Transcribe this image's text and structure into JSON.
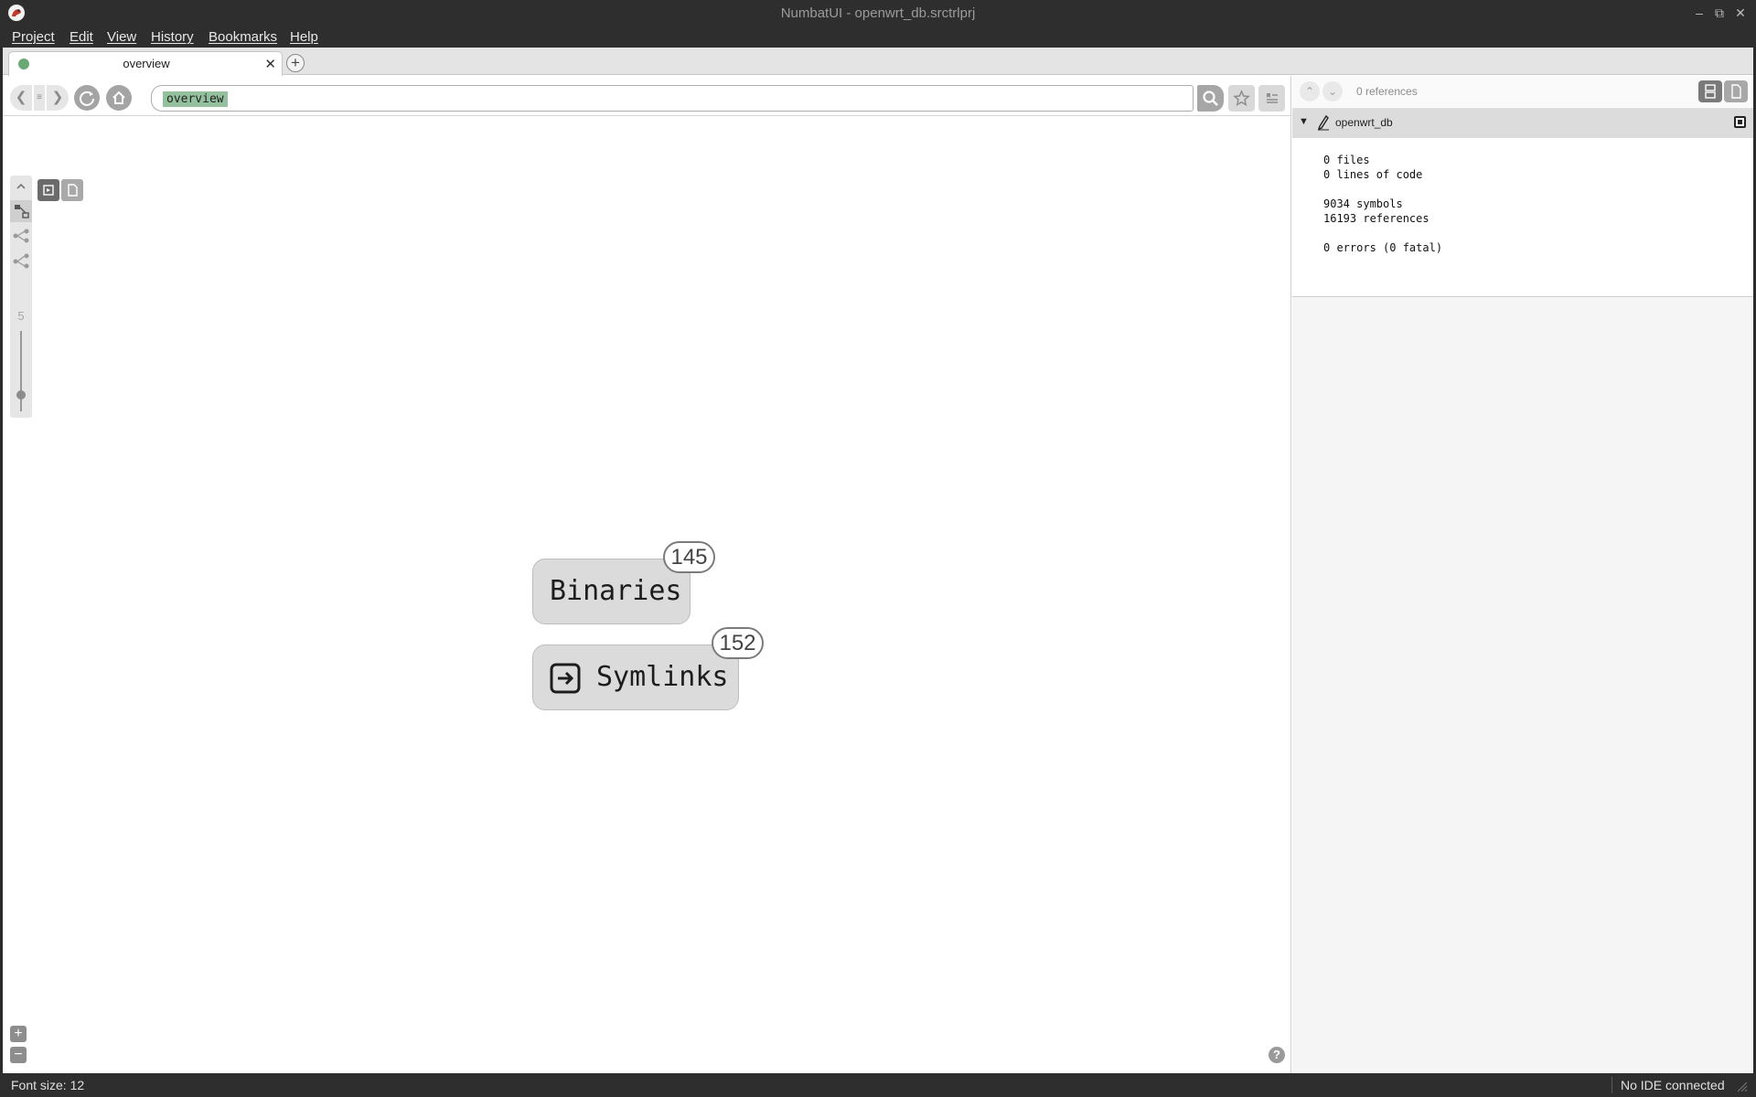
{
  "window": {
    "title": "NumbatUI - openwrt_db.srctrlprj"
  },
  "menu": {
    "items": [
      "Project",
      "Edit",
      "View",
      "History",
      "Bookmarks",
      "Help"
    ]
  },
  "tabs": [
    {
      "label": "overview"
    }
  ],
  "search": {
    "value": "overview"
  },
  "graph": {
    "depth": "5",
    "depth_level": 0.2,
    "nodes": [
      {
        "label": "Binaries",
        "count": "145",
        "icon": ""
      },
      {
        "label": "Symlinks",
        "count": "152",
        "icon": "enter-arrow-icon"
      }
    ]
  },
  "references": {
    "count_label": "0 references"
  },
  "code": {
    "project_name": "openwrt_db",
    "summary": {
      "files": "0 files",
      "loc": "0 lines of code",
      "symbols": "9034 symbols",
      "refs": "16193 references",
      "errors": "0 errors (0 fatal)"
    }
  },
  "status": {
    "font_size": "Font size: 12",
    "ide": "No IDE connected"
  }
}
